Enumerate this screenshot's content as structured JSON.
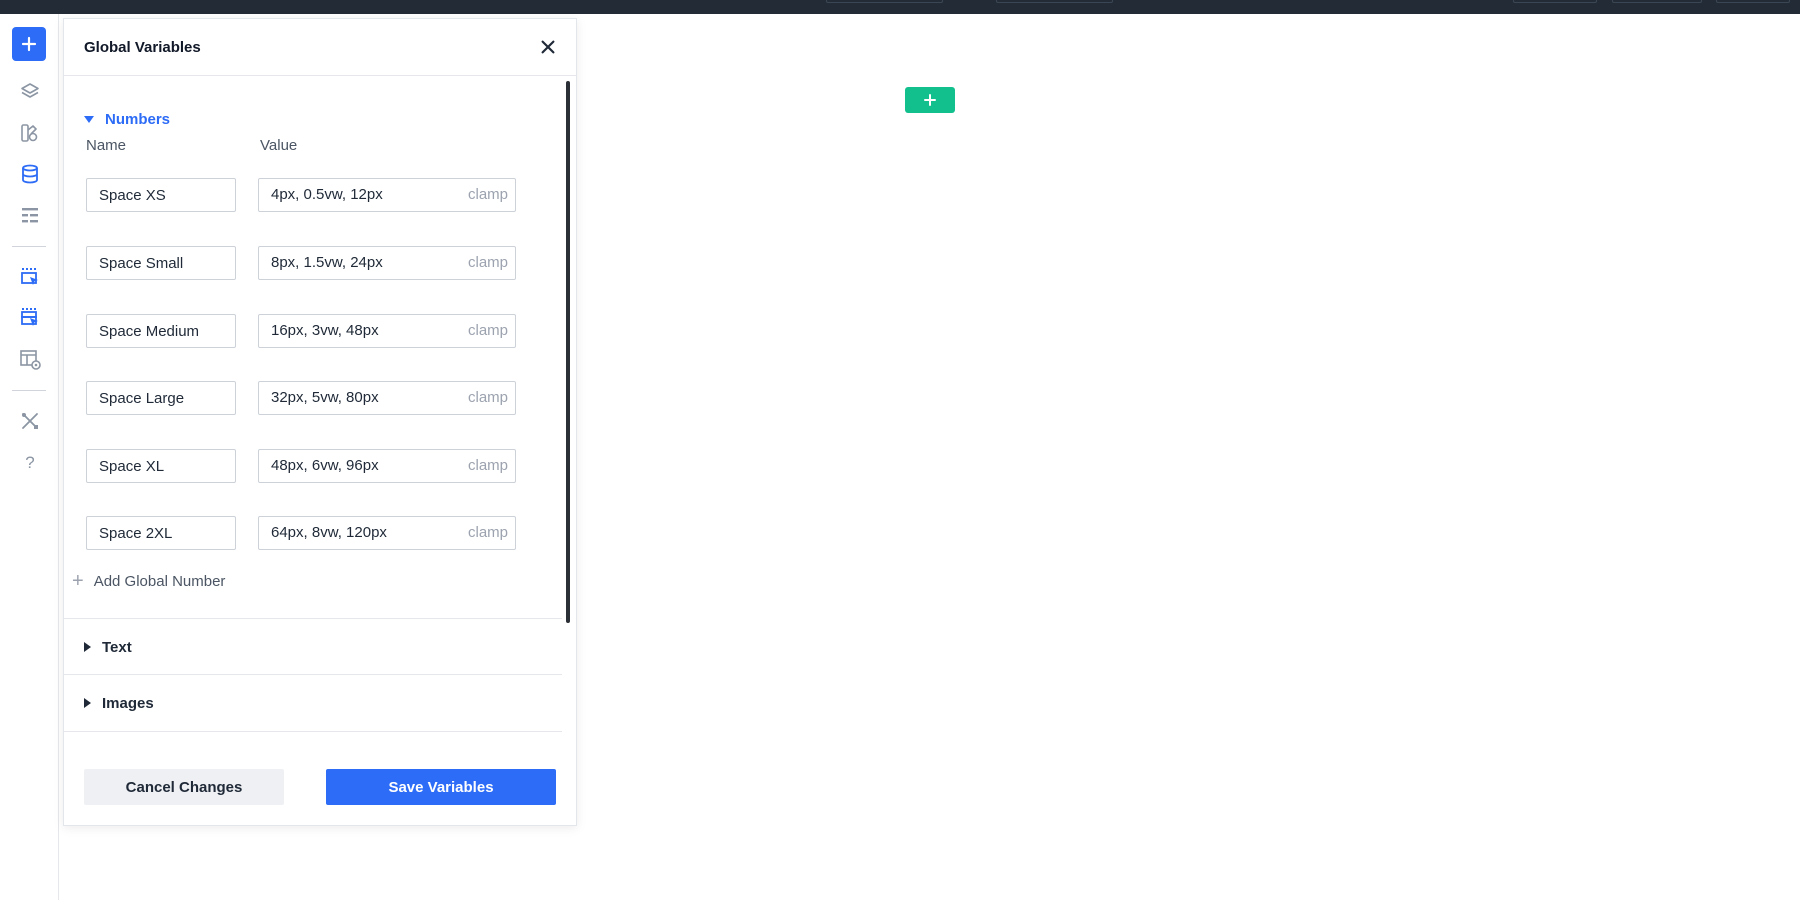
{
  "panel": {
    "title": "Global Variables",
    "close_icon": "close-icon"
  },
  "sections": {
    "numbers": {
      "label": "Numbers",
      "expanded": true,
      "columns": {
        "name": "Name",
        "value": "Value"
      },
      "variables": [
        {
          "name": "Space XS",
          "value": "4px, 0.5vw, 12px",
          "suffix": "clamp"
        },
        {
          "name": "Space Small",
          "value": "8px, 1.5vw, 24px",
          "suffix": "clamp"
        },
        {
          "name": "Space Medium",
          "value": "16px, 3vw, 48px",
          "suffix": "clamp"
        },
        {
          "name": "Space Large",
          "value": "32px, 5vw, 80px",
          "suffix": "clamp"
        },
        {
          "name": "Space XL",
          "value": "48px, 6vw, 96px",
          "suffix": "clamp"
        },
        {
          "name": "Space 2XL",
          "value": "64px, 8vw, 120px",
          "suffix": "clamp"
        }
      ],
      "add_label": "Add Global Number"
    },
    "text": {
      "label": "Text",
      "expanded": false
    },
    "images": {
      "label": "Images",
      "expanded": false
    }
  },
  "footer": {
    "cancel_label": "Cancel Changes",
    "save_label": "Save Variables"
  },
  "sidebar": {
    "icons": [
      "plus-icon",
      "layers-icon",
      "palette-icon",
      "database-icon",
      "list-icon",
      "select-cursor-icon",
      "multi-select-cursor-icon",
      "layout-preview-icon",
      "tools-icon",
      "help-icon"
    ]
  },
  "colors": {
    "accent": "#2d6cf6",
    "canvas_add": "#12c08e",
    "topbar": "#222b36"
  }
}
